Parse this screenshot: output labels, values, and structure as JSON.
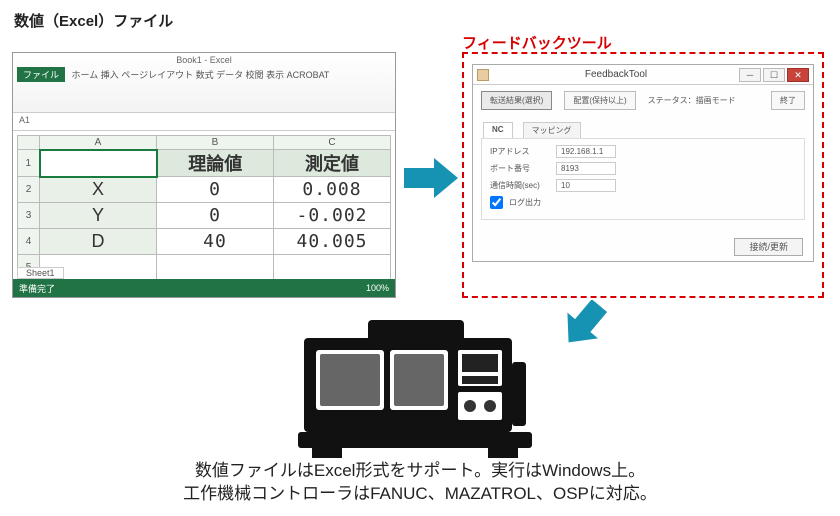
{
  "labels": {
    "excel_file": "数値（Excel）ファイル",
    "feedback_tool": "フィードバックツール"
  },
  "excel": {
    "app_title": "Book1 - Excel",
    "file_tab": "ファイル",
    "ribbon_tabs": "ホーム  挿入  ページレイアウト  数式  データ  校閲  表示  ACROBAT",
    "namebox": "A1",
    "columns": [
      "A",
      "B",
      "C"
    ],
    "header_row": {
      "theory": "理論値",
      "measured": "測定値"
    },
    "rows": [
      {
        "axis": "X",
        "theory": "0",
        "measured": "0.008"
      },
      {
        "axis": "Y",
        "theory": "0",
        "measured": "-0.002"
      },
      {
        "axis": "D",
        "theory": "40",
        "measured": "40.005"
      }
    ],
    "sheet_tab": "Sheet1",
    "status_left": "準備完了",
    "zoom": "100%"
  },
  "feedback": {
    "window_title": "FeedbackTool",
    "btn_send": "転送結果(選択)",
    "btn_meas": "配置(保持以上)",
    "status_label": "ステータス：描画モード",
    "btn_close_top": "終了",
    "tab1": "NC",
    "tab2": "マッピング",
    "params": {
      "ip_label": "IPアドレス",
      "ip_value": "192.168.1.1",
      "port_label": "ポート番号",
      "port_value": "8193",
      "timeout_label": "通信時間(sec)",
      "timeout_value": "10",
      "checkbox_label": "ログ出力"
    },
    "btn_bottom": "接続/更新"
  },
  "caption": {
    "line1": "数値ファイルはExcel形式をサポート。実行はWindows上。",
    "line2": "工作機械コントローラはFANUC、MAZATROL、OSPに対応。"
  }
}
